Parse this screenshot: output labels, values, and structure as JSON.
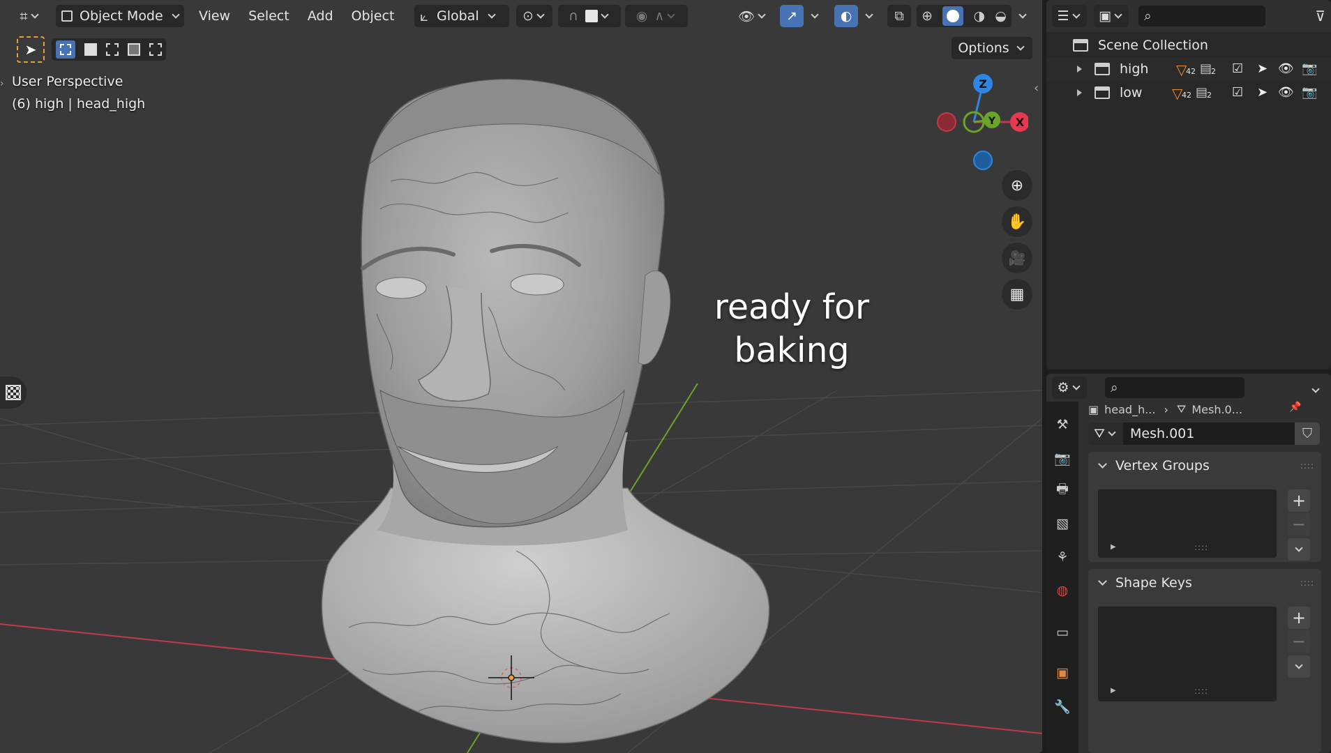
{
  "header": {
    "mode_label": "Object Mode",
    "menus": [
      "View",
      "Select",
      "Add",
      "Object"
    ],
    "transform_orientation": "Global",
    "options_label": "Options"
  },
  "viewport": {
    "view_name": "User Perspective",
    "object_info": "(6) high | head_high",
    "overlay_text": "ready for\nbaking",
    "gizmo": {
      "z_label": "Z",
      "y_label": "Y",
      "x_label": "X"
    },
    "colors": {
      "background": "#393939",
      "x_axis": "#c4384a",
      "y_axis": "#6aa52a",
      "z_axis": "#2f86e0",
      "grid": "#474747"
    }
  },
  "outliner": {
    "scene_collection_label": "Scene Collection",
    "collections": [
      {
        "name": "high",
        "mesh_count": "42",
        "child_count": "2",
        "render_enabled": true
      },
      {
        "name": "low",
        "mesh_count": "42",
        "child_count": "2",
        "render_enabled": false
      }
    ]
  },
  "properties": {
    "breadcrumb": [
      "head_h...",
      "Mesh.0..."
    ],
    "mesh_name": "Mesh.001",
    "panels": [
      {
        "title": "Vertex Groups"
      },
      {
        "title": "Shape Keys"
      }
    ],
    "tabs": [
      "tool",
      "render",
      "output",
      "view-layer",
      "scene",
      "world",
      "collection",
      "object",
      "modifiers"
    ]
  },
  "colors": {
    "accent": "#4772b3",
    "panel": "#303030",
    "header": "#282828",
    "orange": "#e4883a"
  }
}
